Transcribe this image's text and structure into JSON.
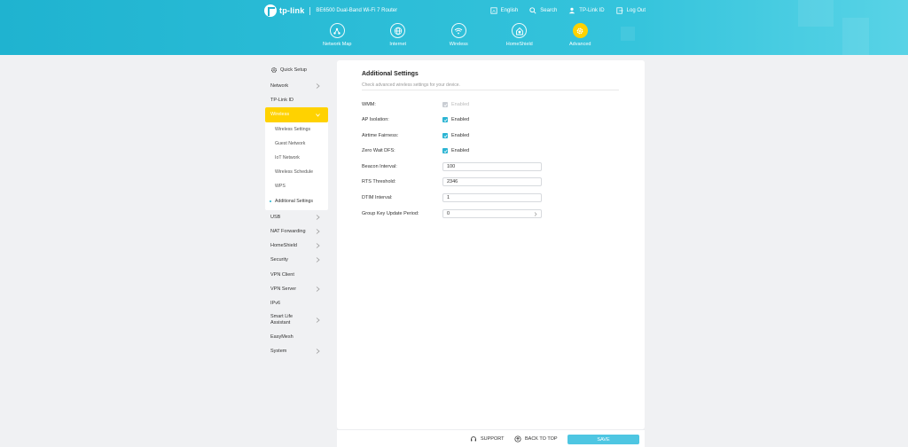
{
  "colors": {
    "header": "#1fb3d0",
    "accent": "#2bb4d3",
    "active": "#ffd200",
    "save": "#4ec6e2"
  },
  "brand": {
    "logo": "tp-link",
    "model": "BE6500 Dual-Band Wi-Fi 7 Router"
  },
  "toplinks": [
    {
      "icon": "language-icon",
      "label": "English"
    },
    {
      "icon": "search-icon",
      "label": "Search"
    },
    {
      "icon": "account-icon",
      "label": "TP-Link ID"
    },
    {
      "icon": "logout-icon",
      "label": "Log Out"
    }
  ],
  "mainnav": [
    {
      "icon": "network-map-icon",
      "label": "Network Map"
    },
    {
      "icon": "globe-icon",
      "label": "Internet"
    },
    {
      "icon": "wifi-icon",
      "label": "Wireless"
    },
    {
      "icon": "homeshield-icon",
      "label": "HomeShield"
    },
    {
      "icon": "gear-icon",
      "label": "Advanced",
      "active": true
    }
  ],
  "sidebar": {
    "quick_setup": "Quick Setup",
    "items_before": [
      {
        "label": "Network"
      },
      {
        "label": "TP-Link ID"
      }
    ],
    "active": "Wireless",
    "subitems": [
      "Wireless Settings",
      "Guest Network",
      "IoT Network",
      "Wireless Schedule",
      "WPS",
      "Additional Settings"
    ],
    "items_after": [
      {
        "label": "USB"
      },
      {
        "label": "NAT Forwarding"
      },
      {
        "label": "HomeShield"
      },
      {
        "label": "Security"
      },
      {
        "label": "VPN Client"
      },
      {
        "label": "VPN Server"
      },
      {
        "label": "IPv6"
      },
      {
        "label": "Smart Life Assistant"
      },
      {
        "label": "EasyMesh"
      },
      {
        "label": "System"
      }
    ]
  },
  "main": {
    "title": "Additional Settings",
    "description": "Check advanced wireless settings for your device.",
    "wmm": {
      "label": "WMM:",
      "text": "Enabled"
    },
    "ap_isolation": {
      "label": "AP Isolation:",
      "text": "Enabled"
    },
    "airtime_fairness": {
      "label": "Airtime Fairness:",
      "text": "Enabled"
    },
    "zero_wait_dfs": {
      "label": "Zero Wait DFS:",
      "text": "Enabled"
    },
    "beacon_interval": {
      "label": "Beacon Interval:",
      "value": "100"
    },
    "rts_threshold": {
      "label": "RTS Threshold:",
      "value": "2346"
    },
    "dtim_interval": {
      "label": "DTIM Interval:",
      "value": "1"
    },
    "group_key": {
      "label": "Group Key Update Period:",
      "value": "0"
    }
  },
  "footer": {
    "support": "SUPPORT",
    "back_to_top": "BACK TO TOP",
    "save": "SAVE"
  }
}
